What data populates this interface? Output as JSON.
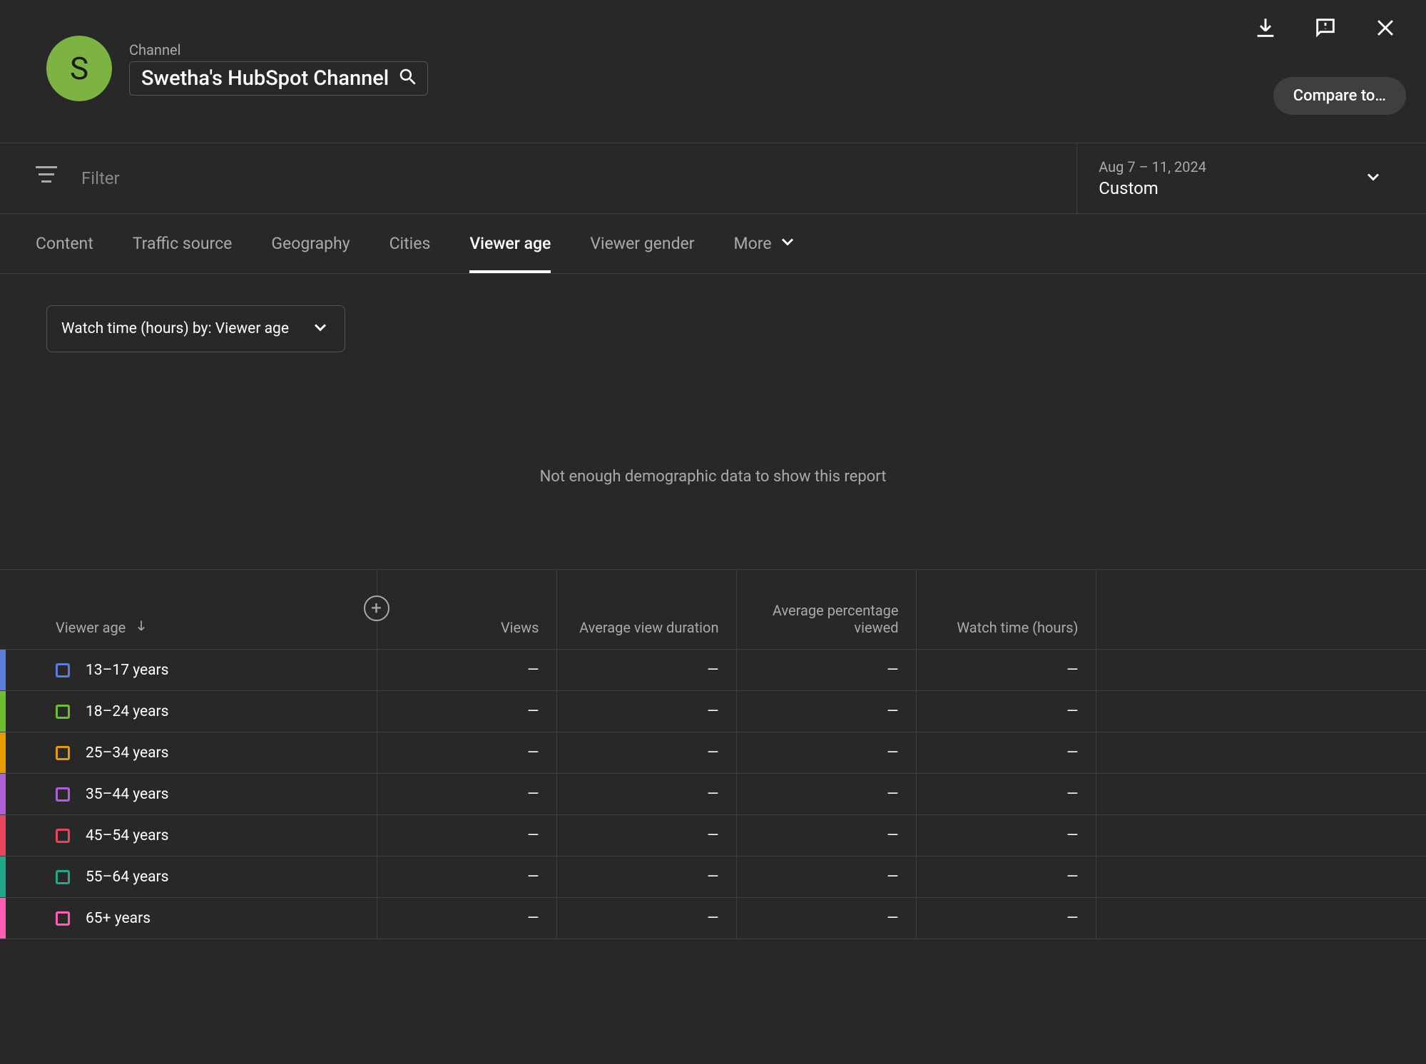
{
  "header": {
    "avatar_initial": "S",
    "channel_label": "Channel",
    "channel_name": "Swetha's HubSpot Channel",
    "compare_label": "Compare to…"
  },
  "filter": {
    "placeholder": "Filter",
    "date_range": "Aug 7 – 11, 2024",
    "date_label": "Custom"
  },
  "tabs": {
    "items": [
      "Content",
      "Traffic source",
      "Geography",
      "Cities",
      "Viewer age",
      "Viewer gender"
    ],
    "more_label": "More",
    "active_index": 4
  },
  "metric_select": {
    "label": "Watch time (hours) by: Viewer age"
  },
  "chart": {
    "empty_message": "Not enough demographic data to show this report"
  },
  "table": {
    "name_column": "Viewer age",
    "columns": [
      "Views",
      "Average view duration",
      "Average percentage viewed",
      "Watch time (hours)"
    ],
    "rows": [
      {
        "label": "13–17 years",
        "color": "#5a7de0",
        "values": [
          "—",
          "—",
          "—",
          "—"
        ]
      },
      {
        "label": "18–24 years",
        "color": "#6cbf2e",
        "values": [
          "—",
          "—",
          "—",
          "—"
        ]
      },
      {
        "label": "25–34 years",
        "color": "#e69b00",
        "values": [
          "—",
          "—",
          "—",
          "—"
        ]
      },
      {
        "label": "35–44 years",
        "color": "#b05fd9",
        "values": [
          "—",
          "—",
          "—",
          "—"
        ]
      },
      {
        "label": "45–54 years",
        "color": "#e8475f",
        "values": [
          "—",
          "—",
          "—",
          "—"
        ]
      },
      {
        "label": "55–64 years",
        "color": "#1fa98a",
        "values": [
          "—",
          "—",
          "—",
          "—"
        ]
      },
      {
        "label": "65+ years",
        "color": "#ff5fb3",
        "values": [
          "—",
          "—",
          "—",
          "—"
        ]
      }
    ]
  }
}
